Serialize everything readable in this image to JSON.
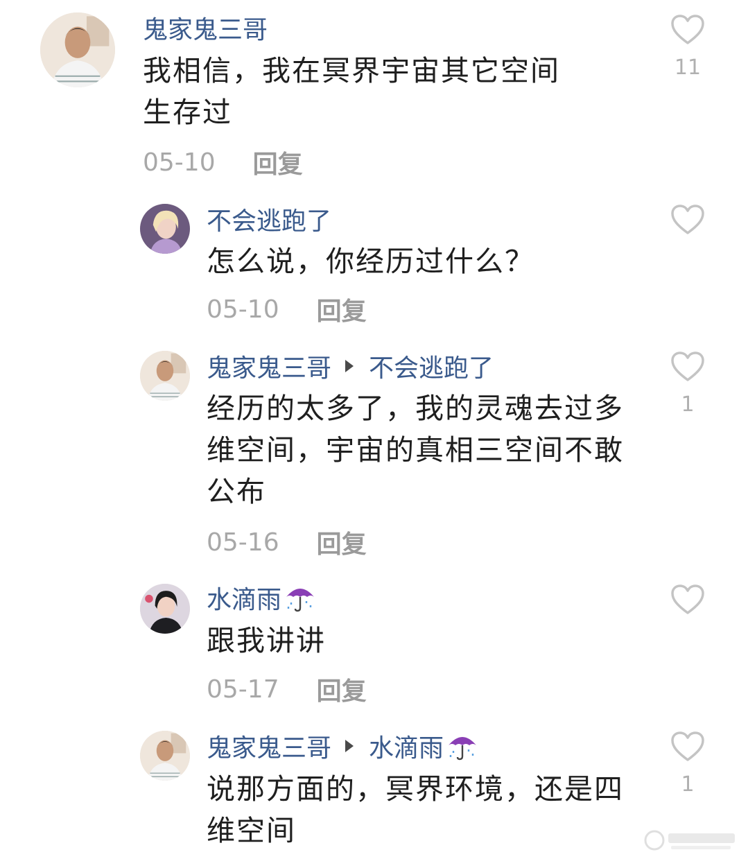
{
  "comments": [
    {
      "author": "鬼家鬼三哥",
      "text": "我相信，我在冥界宇宙其它空间生存过",
      "date": "05-10",
      "reply_label": "回复",
      "likes": "11"
    },
    {
      "author": "不会逃跑了",
      "text": "怎么说，你经历过什么？",
      "date": "05-10",
      "reply_label": "回复",
      "likes": ""
    },
    {
      "author": "鬼家鬼三哥",
      "reply_to": "不会逃跑了",
      "text": "经历的太多了，我的灵魂去过多维空间，宇宙的真相三空间不敢公布",
      "date": "05-16",
      "reply_label": "回复",
      "likes": "1"
    },
    {
      "author": "水滴雨",
      "author_icon": "umbrella-icon",
      "text": "跟我讲讲",
      "date": "05-17",
      "reply_label": "回复",
      "likes": ""
    },
    {
      "author": "鬼家鬼三哥",
      "reply_to": "水滴雨",
      "reply_to_icon": "umbrella-icon",
      "text": "说那方面的，冥界环境，还是四维空间",
      "likes": "1"
    }
  ],
  "colors": {
    "author_name": "#3a5a8c",
    "meta_text": "#a8a8a8",
    "body_text": "#1f1f1f",
    "umbrella": "#8a3fb5"
  }
}
